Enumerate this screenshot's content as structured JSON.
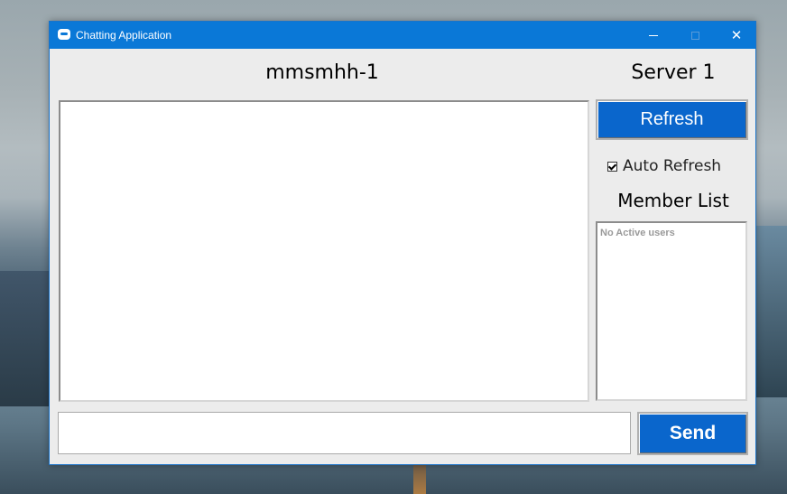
{
  "window": {
    "title": "Chatting Application",
    "icon": "chat-bubble-icon",
    "controls": {
      "minimize": "minimize-icon",
      "maximize": "maximize-icon",
      "close": "✕"
    }
  },
  "header": {
    "username": "mmsmhh-1",
    "server": "Server 1"
  },
  "sidebar": {
    "refresh_label": "Refresh",
    "auto_refresh_label": "Auto Refresh",
    "auto_refresh_checked": true,
    "member_list_title": "Member List",
    "member_list_empty": "No Active users"
  },
  "composer": {
    "message_value": "",
    "send_label": "Send"
  },
  "colors": {
    "titlebar": "#0a78d7",
    "button": "#0a66cc",
    "window_bg": "#ececec"
  }
}
